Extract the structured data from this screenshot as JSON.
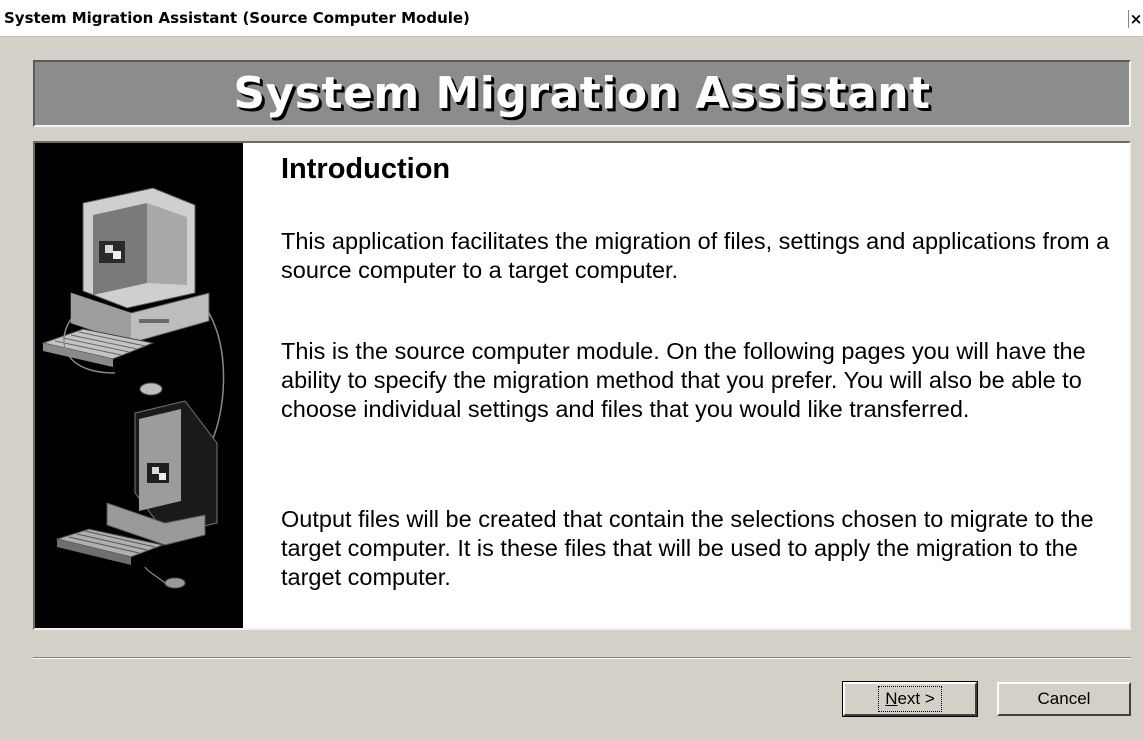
{
  "window": {
    "title": "System Migration Assistant (Source Computer Module)",
    "close_glyph": "×"
  },
  "banner": {
    "title": "System Migration Assistant"
  },
  "page": {
    "heading": "Introduction",
    "paragraphs": [
      "This application facilitates the migration of files, settings and applications from a source computer to a target computer.",
      "This is the source computer module.  On the following pages you will have the ability to specify the migration method that you prefer.  You will also be able to choose individual settings and files that you would like transferred.",
      "Output files will be created that contain the selections chosen to migrate to the target computer.  It is these files that will be used to apply the migration to the target computer."
    ]
  },
  "buttons": {
    "next_mnemonic": "N",
    "next_rest": "ext >",
    "cancel": "Cancel"
  },
  "colors": {
    "dialog_background": "#d4d0c8",
    "banner_background": "#8c8c8c",
    "art_background": "#000000"
  },
  "icons": {
    "art": "two-computers-illustration",
    "close": "close-icon"
  }
}
